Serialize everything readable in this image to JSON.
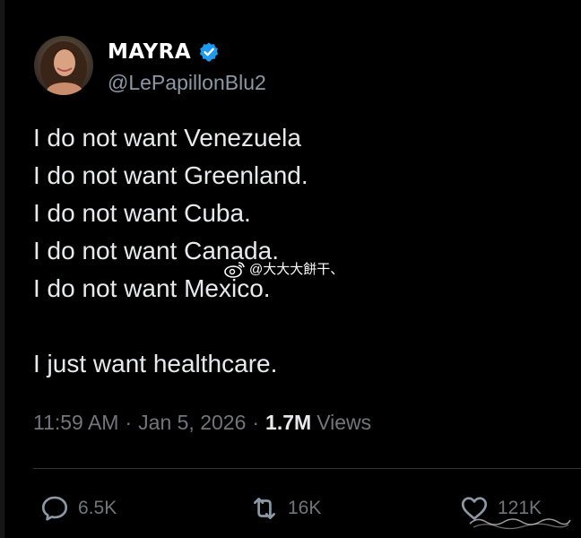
{
  "user": {
    "display_name": "MAYRA",
    "handle": "@LePapillonBlu2",
    "verified": true,
    "verified_color": "#1d9bf0"
  },
  "tweet": {
    "lines": [
      "I do not want Venezuela",
      "I do not want Greenland.",
      "I do not want Cuba.",
      "I do not want Canada.",
      "I do not want Mexico."
    ],
    "closing_line": "I just want healthcare."
  },
  "meta": {
    "time": "11:59 AM",
    "separator": "·",
    "date": "Jan 5, 2026",
    "views_count": "1.7M",
    "views_label": "Views"
  },
  "actions": {
    "replies": "6.5K",
    "reposts": "16K",
    "likes": "121K"
  },
  "watermark": {
    "text": "@大大大餅干、"
  },
  "icons": {
    "reply": "reply-icon",
    "repost": "repost-icon",
    "like": "heart-icon",
    "verified": "verified-badge-icon",
    "watermark_logo": "weibo-logo-icon"
  },
  "colors": {
    "background": "#000000",
    "text": "#e7e9ea",
    "secondary_text": "#71767b",
    "handle_text": "#8b98a5",
    "divider": "#2f3336"
  }
}
